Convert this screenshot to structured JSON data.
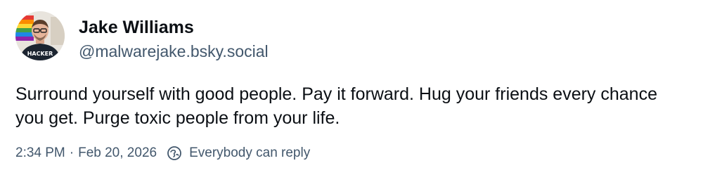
{
  "author": {
    "display_name": "Jake Williams",
    "handle": "@malwarejake.bsky.social",
    "avatar_icon": "user-avatar-photo",
    "avatar_shirt_text": "HACKER"
  },
  "post": {
    "text": "Surround yourself with good people. Pay it forward. Hug your friends every chance you get. Purge toxic people from your life."
  },
  "meta": {
    "time": "2:34 PM",
    "separator": "·",
    "date": "Feb 20, 2026",
    "reply_setting": "Everybody can reply",
    "reply_icon": "globe-reply-icon"
  },
  "colors": {
    "text_primary": "#0b0f14",
    "text_secondary": "#42576c",
    "background": "#ffffff"
  }
}
